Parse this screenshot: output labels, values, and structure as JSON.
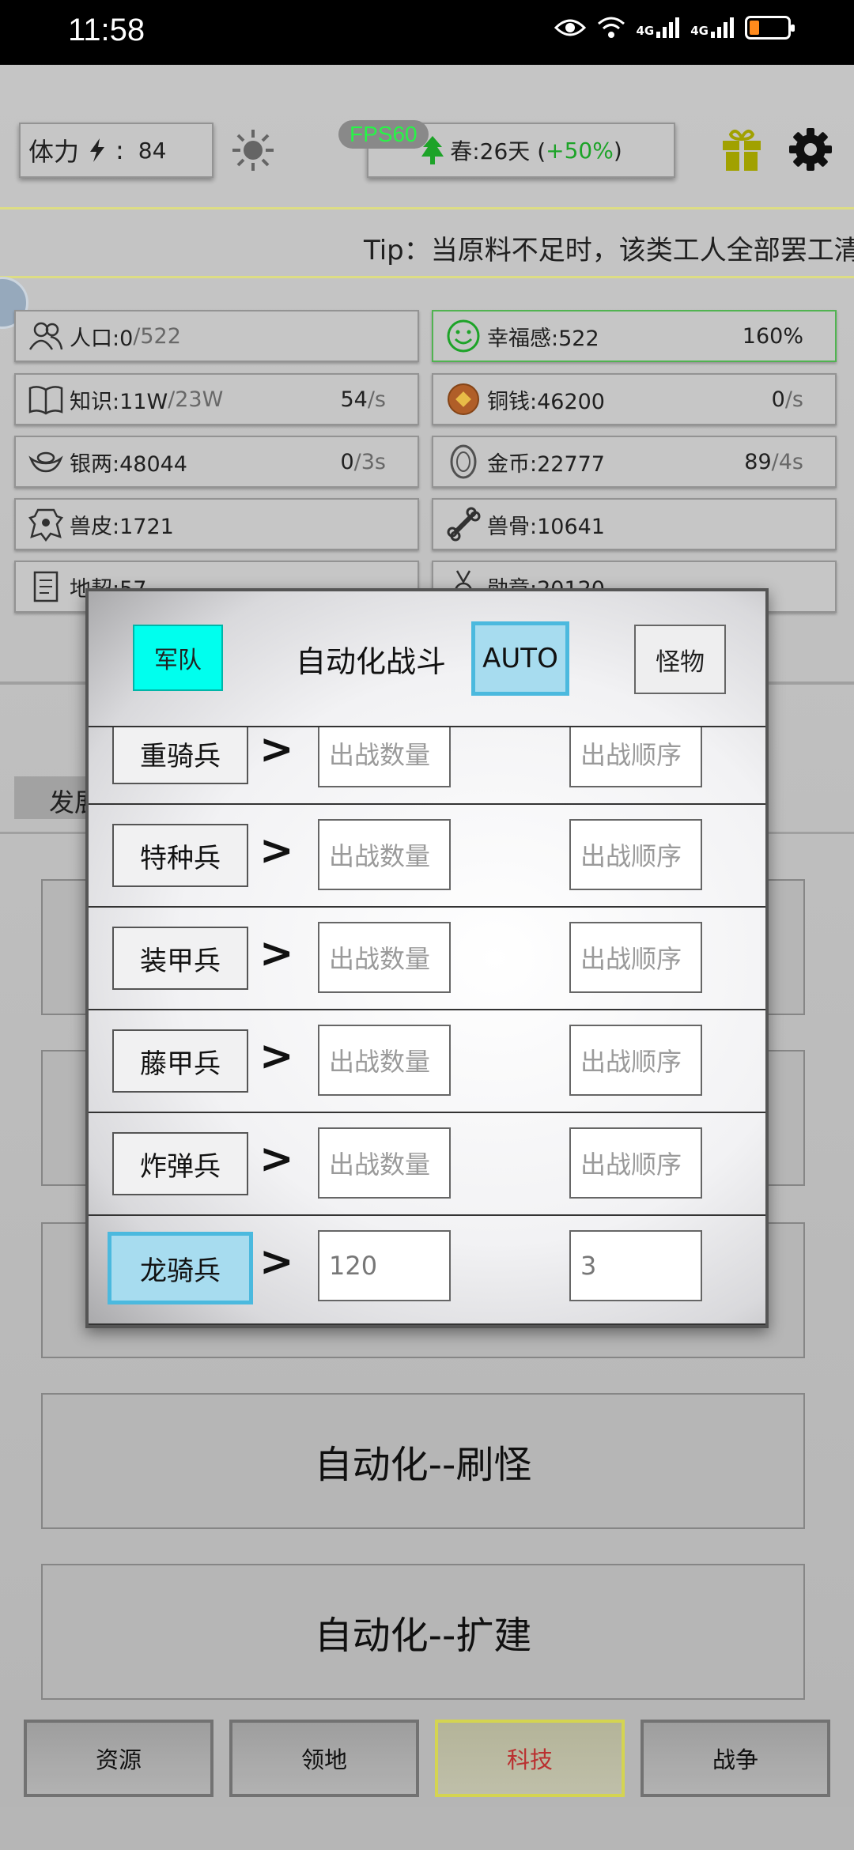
{
  "status_bar": {
    "time": "11:58",
    "net1": "4G",
    "net2": "4G"
  },
  "top": {
    "stamina_label": "体力",
    "stamina_sep": ":",
    "stamina_value": "84",
    "fps": "FPS60",
    "season_label": "春:26天 (",
    "season_bonus": "+50%",
    "season_close": ")"
  },
  "tip": "Tip：当原料不足时，该类工人全部罢工清",
  "resources": [
    {
      "label": "人口:0",
      "max": "/522",
      "rate": "",
      "rate_unit": ""
    },
    {
      "label": "幸福感:522",
      "max": "",
      "rate": "160%",
      "rate_unit": ""
    },
    {
      "label": "知识:11W",
      "max": "/23W",
      "rate": "54",
      "rate_unit": "/s"
    },
    {
      "label": "铜钱:46200",
      "max": "",
      "rate": "0",
      "rate_unit": "/s"
    },
    {
      "label": "银两:48044",
      "max": "",
      "rate": "0",
      "rate_unit": "/3s"
    },
    {
      "label": "金币:22777",
      "max": "",
      "rate": "89",
      "rate_unit": "/4s"
    },
    {
      "label": "兽皮:1721",
      "max": "",
      "rate": "",
      "rate_unit": ""
    },
    {
      "label": "兽骨:10641",
      "max": "",
      "rate": "",
      "rate_unit": ""
    },
    {
      "label": "地契:57",
      "max": "",
      "rate": "",
      "rate_unit": ""
    },
    {
      "label": "勋章:20120",
      "max": "",
      "rate": "",
      "rate_unit": ""
    }
  ],
  "background": {
    "develop_tab": "发展",
    "auto_grind": "自动化--刷怪",
    "auto_build": "自动化--扩建"
  },
  "modal": {
    "tab_army": "军队",
    "title": "自动化战斗",
    "auto": "AUTO",
    "tab_monster": "怪物",
    "arrow": ">",
    "qty_placeholder": "出战数量",
    "order_placeholder": "出战顺序",
    "units": [
      {
        "name": "重骑兵",
        "qty": "",
        "order": ""
      },
      {
        "name": "特种兵",
        "qty": "",
        "order": ""
      },
      {
        "name": "装甲兵",
        "qty": "",
        "order": ""
      },
      {
        "name": "藤甲兵",
        "qty": "",
        "order": ""
      },
      {
        "name": "炸弹兵",
        "qty": "",
        "order": ""
      },
      {
        "name": "龙骑兵",
        "qty": "120",
        "order": "3",
        "selected": true
      }
    ]
  },
  "nav": {
    "resources": "资源",
    "territory": "领地",
    "tech": "科技",
    "war": "战争"
  },
  "colors": {
    "accent_cyan": "#00ffee",
    "selected_blue": "#a7dcef",
    "fps_green": "#29ff4a",
    "bonus_green": "#1faa2a",
    "tech_active_border": "#dddd55"
  }
}
